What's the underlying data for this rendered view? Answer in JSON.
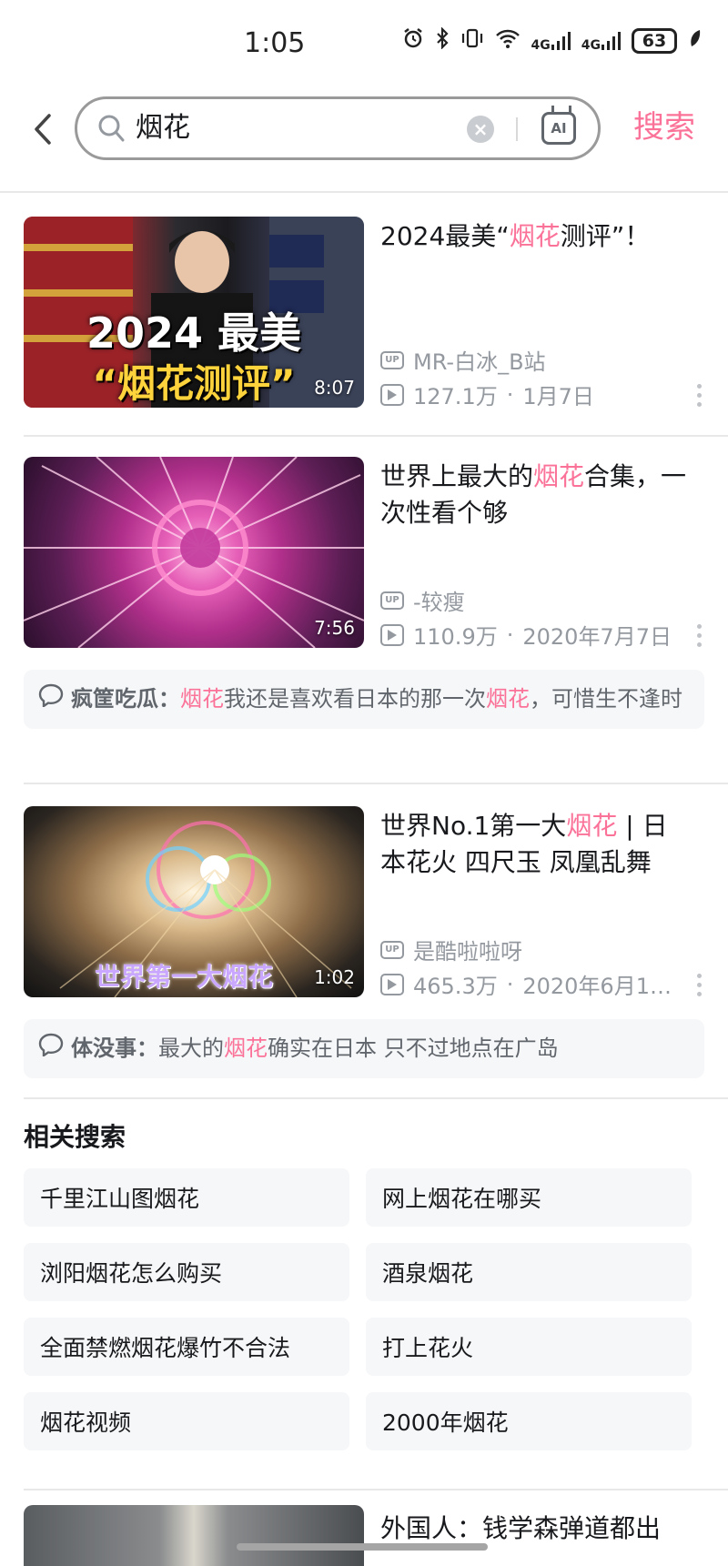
{
  "status_bar": {
    "time": "1:05",
    "battery": "63",
    "network_1": "4G",
    "network_2": "4G"
  },
  "search": {
    "query": "烟花",
    "ai_label": "AI",
    "submit_label": "搜索"
  },
  "videos": [
    {
      "title_parts": [
        "2024最美“",
        "烟花",
        "测评”！"
      ],
      "thumb_text_1": "2024 最美",
      "thumb_text_2": "“烟花测评”",
      "duration": "8:07",
      "uploader": "MR-白冰_B站",
      "views": "127.1万",
      "date": "1月7日"
    },
    {
      "title_parts": [
        "世界上最大的",
        "烟花",
        "合集，一次性看个够"
      ],
      "duration": "7:56",
      "uploader": "-较瘦",
      "views": "110.9万",
      "date": "2020年7月7日",
      "comment": {
        "user": "疯筐吃瓜：",
        "parts": [
          "烟花",
          "我还是喜欢看日本的那一次",
          "烟花",
          "，可惜生不逢时"
        ]
      }
    },
    {
      "title_parts": [
        "世界No.1第一大",
        "烟花",
        " | 日本花火 四尺玉 凤凰乱舞"
      ],
      "thumb_text": "世界第一大烟花",
      "duration": "1:02",
      "uploader": "是酷啦啦呀",
      "views": "465.3万",
      "date": "2020年6月1…",
      "comment": {
        "user": "体没事：",
        "parts": [
          "最大的",
          "烟花",
          "确实在日本 只不过地点在广岛"
        ]
      }
    }
  ],
  "related": {
    "title": "相关搜索",
    "items": [
      "千里江山图烟花",
      "网上烟花在哪买",
      "浏阳烟花怎么购买",
      "酒泉烟花",
      "全面禁燃烟花爆竹不合法",
      "打上花火",
      "烟花视频",
      "2000年烟花"
    ]
  },
  "partial_video": {
    "title": "外国人：钱学森弹道都出"
  },
  "colors": {
    "accent": "#fb7299",
    "text": "#18191c",
    "muted": "#9499a0"
  }
}
